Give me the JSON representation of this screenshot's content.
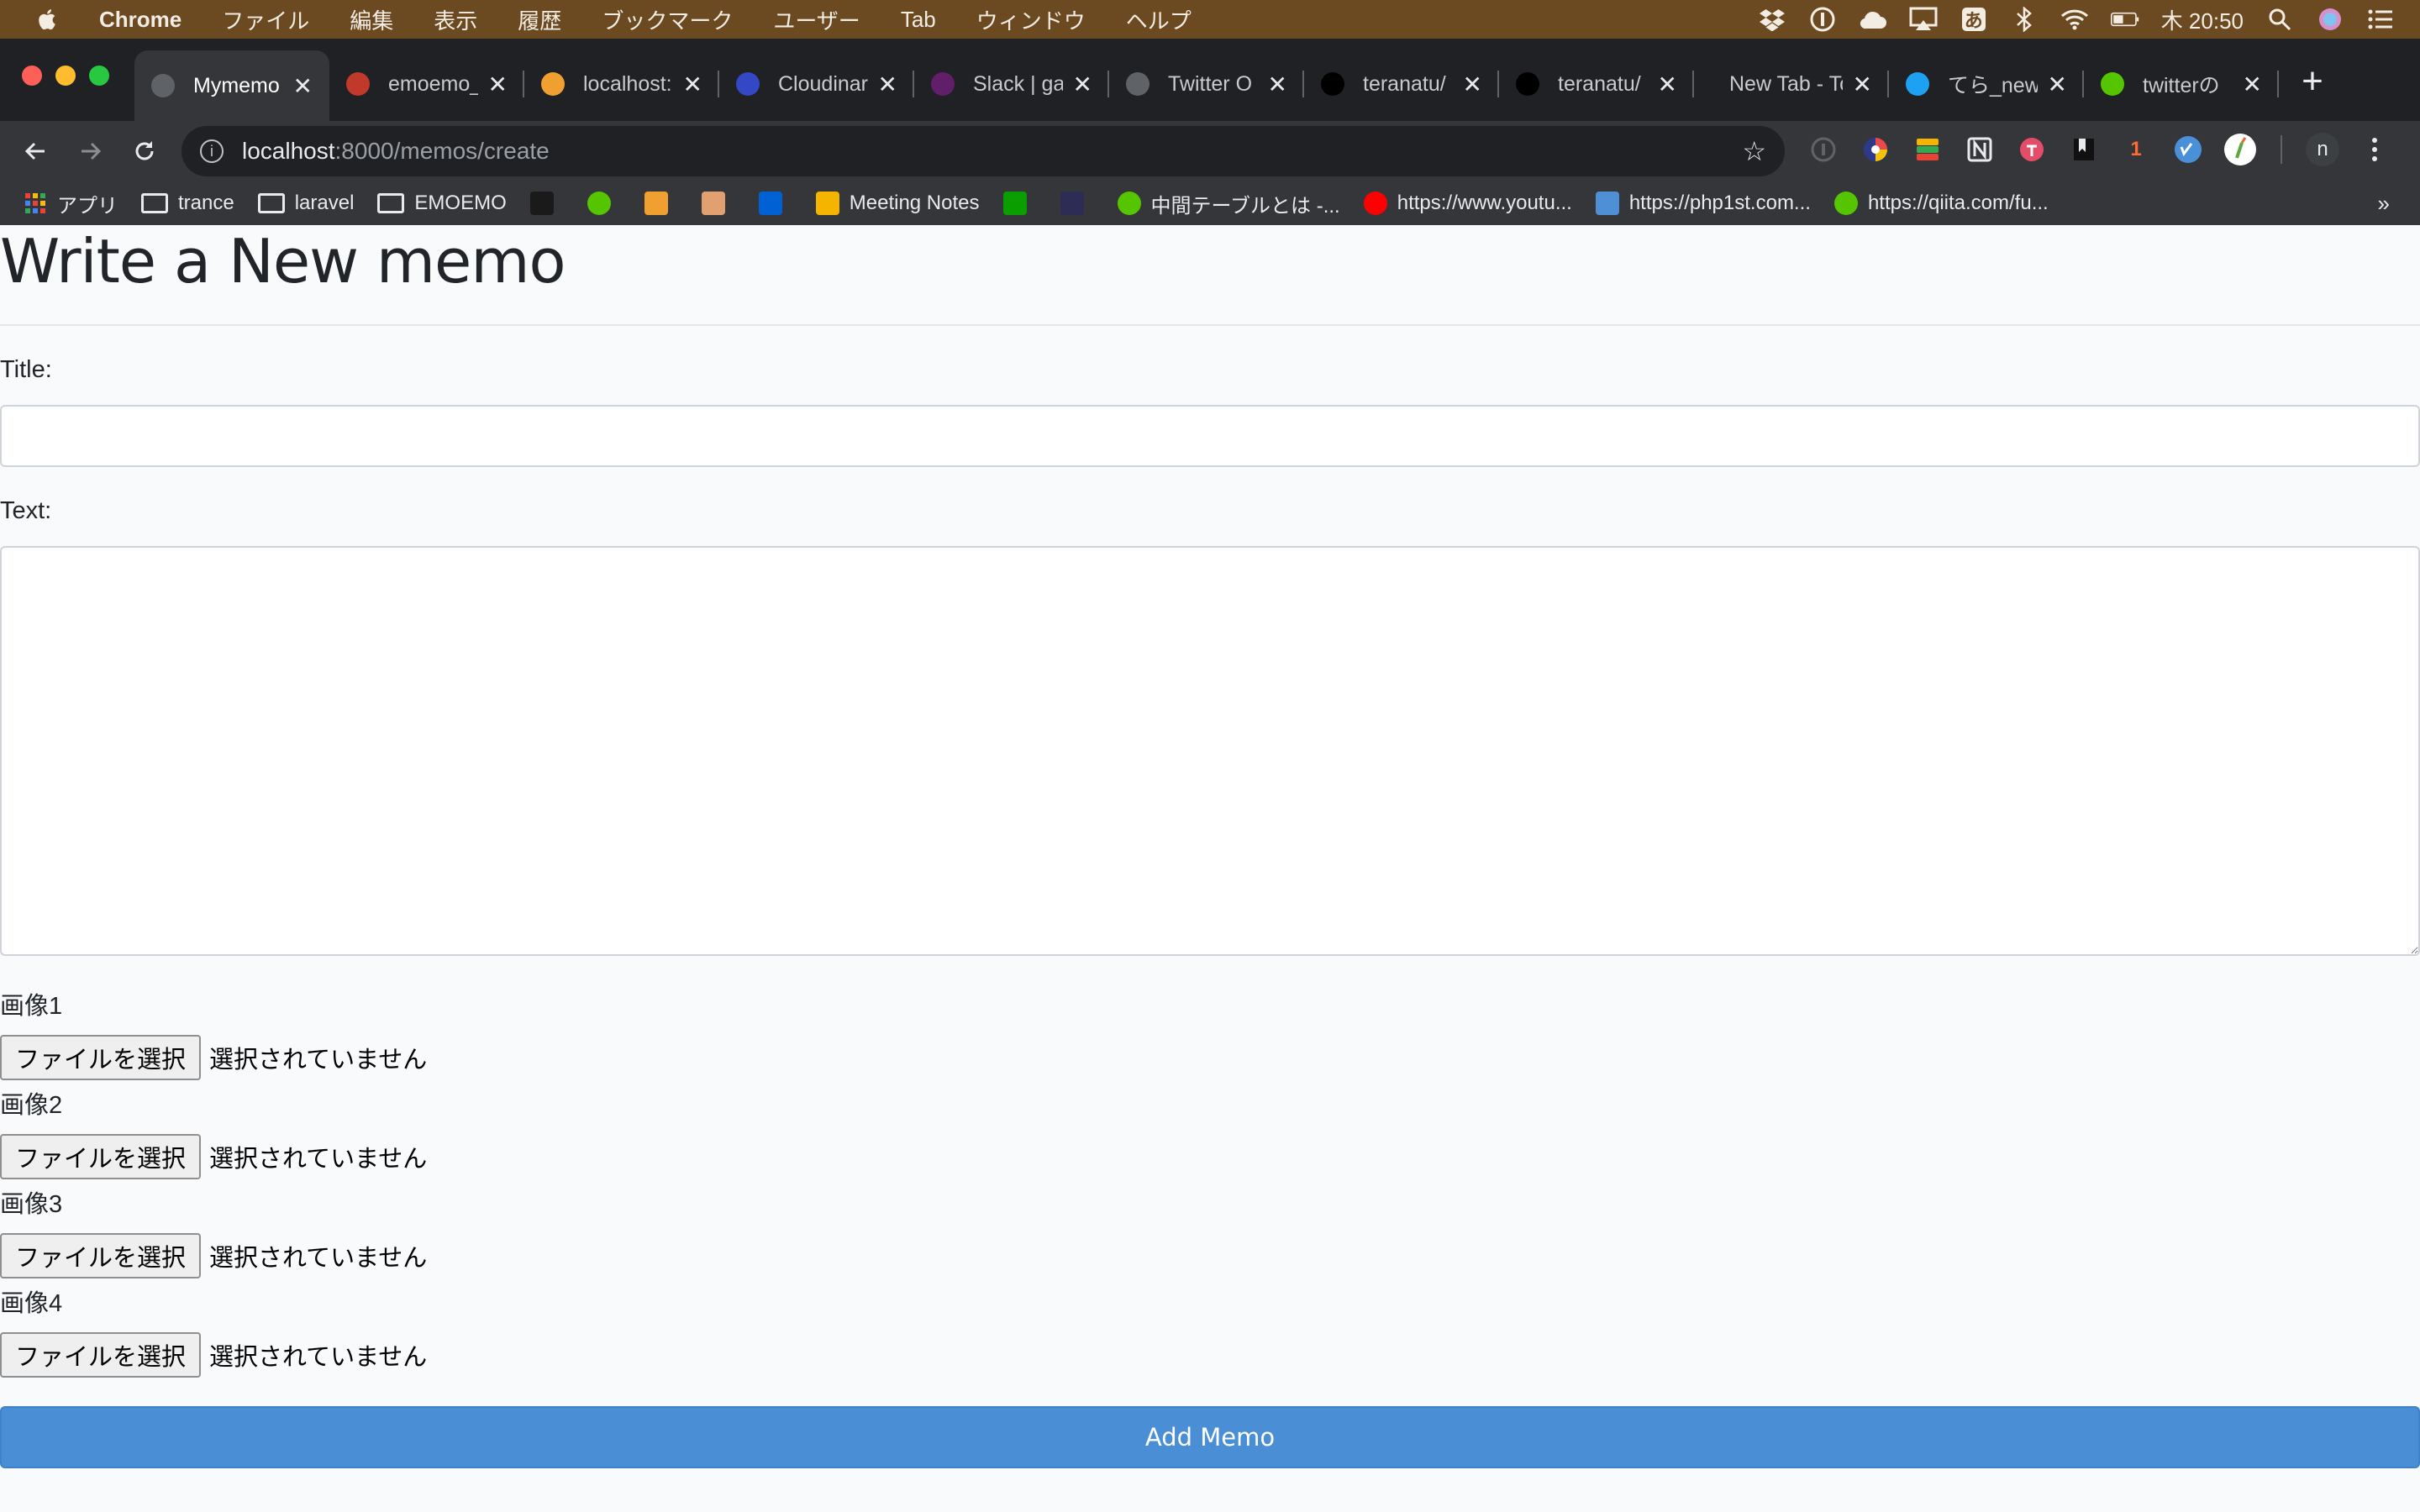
{
  "menubar": {
    "app_name": "Chrome",
    "items": [
      "ファイル",
      "編集",
      "表示",
      "履歴",
      "ブックマーク",
      "ユーザー",
      "Tab",
      "ウィンドウ",
      "ヘルプ"
    ],
    "status_icons": [
      "dropbox-icon",
      "onepassword-icon",
      "cloud-icon",
      "airplay-icon",
      "input-method-icon",
      "bluetooth-icon",
      "wifi-icon",
      "battery-icon"
    ],
    "input_method_label": "あ",
    "clock": "木 20:50"
  },
  "tabs": [
    {
      "title": "Mymemo",
      "active": true,
      "favicon": "globe-icon",
      "color": "#5f6368"
    },
    {
      "title": "emoemo_",
      "active": false,
      "favicon": "bag-icon",
      "color": "#c0392b"
    },
    {
      "title": "localhost:",
      "active": false,
      "favicon": "laravel-icon",
      "color": "#f0a030"
    },
    {
      "title": "Cloudinar",
      "active": false,
      "favicon": "cloudinary-icon",
      "color": "#3448c5"
    },
    {
      "title": "Slack | ga",
      "active": false,
      "favicon": "slack-icon",
      "color": "#611f69"
    },
    {
      "title": "Twitter O",
      "active": false,
      "favicon": "globe-icon",
      "color": "#5f6368"
    },
    {
      "title": "teranatu/",
      "active": false,
      "favicon": "github-icon",
      "color": "#000000"
    },
    {
      "title": "teranatu/",
      "active": false,
      "favicon": "github-icon",
      "color": "#000000"
    },
    {
      "title": "New Tab - Tob",
      "active": false,
      "favicon": "",
      "color": "#35363a"
    },
    {
      "title": "てら_new",
      "active": false,
      "favicon": "twitter-icon",
      "color": "#1da1f2"
    },
    {
      "title": "twitterの",
      "active": false,
      "favicon": "qiita-icon",
      "color": "#55c500"
    }
  ],
  "toolbar": {
    "url_host": "localhost",
    "url_path": ":8000/memos/create"
  },
  "extensions": [
    "ext-1password",
    "ext-colorful",
    "ext-stack",
    "ext-notion",
    "ext-todoist",
    "ext-bookmark",
    "ext-one",
    "ext-vimeo",
    "ext-vegetable",
    "profile-avatar",
    "menu"
  ],
  "ext_labels": {
    "one": "1",
    "avatar": "n"
  },
  "bookmarks": {
    "apps_label": "アプリ",
    "items": [
      {
        "label": "trance",
        "type": "folder"
      },
      {
        "label": "laravel",
        "type": "folder"
      },
      {
        "label": "EMOEMO",
        "type": "folder"
      },
      {
        "label": "",
        "type": "icon",
        "icon": "t-icon",
        "color": "#1a1a1a"
      },
      {
        "label": "",
        "type": "icon",
        "icon": "qiita-icon",
        "color": "#55c500"
      },
      {
        "label": "",
        "type": "icon",
        "icon": "laravel-icon",
        "color": "#f0a030"
      },
      {
        "label": "",
        "type": "icon",
        "icon": "ninja-icon",
        "color": "#e0a070"
      },
      {
        "label": "",
        "type": "icon",
        "icon": "box-icon",
        "color": "#0061d5"
      },
      {
        "label": "Meeting Notes",
        "type": "icon",
        "icon": "pencil-icon",
        "color": "#f4b400"
      },
      {
        "label": "",
        "type": "icon",
        "icon": "techcrunch-icon",
        "color": "#0a9e01"
      },
      {
        "label": "",
        "type": "icon",
        "icon": "h-icon",
        "color": "#2c2c54"
      },
      {
        "label": "中間テーブルとは -...",
        "type": "icon",
        "icon": "qiita-icon",
        "color": "#55c500"
      },
      {
        "label": "https://www.youtu...",
        "type": "icon",
        "icon": "youtube-icon",
        "color": "#ff0000"
      },
      {
        "label": "https://php1st.com...",
        "type": "icon",
        "icon": "php-icon",
        "color": "#4f8fd6"
      },
      {
        "label": "https://qiita.com/fu...",
        "type": "icon",
        "icon": "qiita-icon",
        "color": "#55c500"
      }
    ],
    "more": "»"
  },
  "page": {
    "title": "Write a New memo",
    "title_label": "Title:",
    "title_value": "",
    "text_label": "Text:",
    "text_value": "",
    "images": [
      {
        "label": "画像1",
        "button": "ファイルを選択",
        "status": "選択されていません"
      },
      {
        "label": "画像2",
        "button": "ファイルを選択",
        "status": "選択されていません"
      },
      {
        "label": "画像3",
        "button": "ファイルを選択",
        "status": "選択されていません"
      },
      {
        "label": "画像4",
        "button": "ファイルを選択",
        "status": "選択されていません"
      }
    ],
    "submit_label": "Add Memo"
  },
  "colors": {
    "menubar_bg": "#6b4a22",
    "chrome_bg": "#202124",
    "toolbar_bg": "#35363a",
    "page_bg": "#f8fafc",
    "submit_bg": "#4a8fd6"
  }
}
